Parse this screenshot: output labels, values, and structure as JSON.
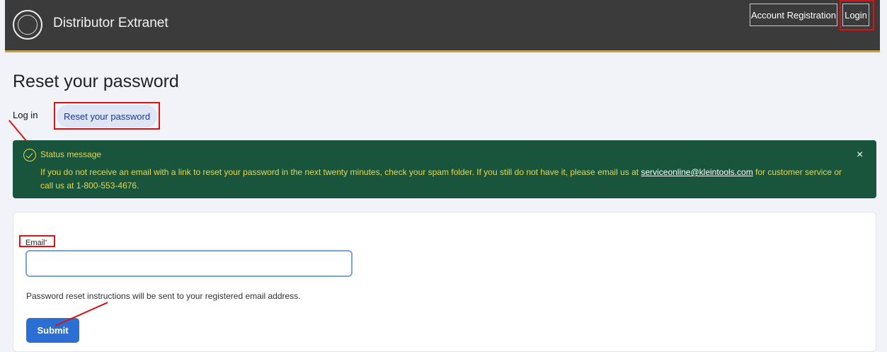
{
  "header": {
    "logo_text": "KLEIN TOOLS EST 1857",
    "site_title": "Distributor Extranet",
    "account_registration_label": "Account Registration",
    "login_label": "Login"
  },
  "page": {
    "title": "Reset your password"
  },
  "tabs": [
    {
      "label": "Log in",
      "active": false
    },
    {
      "label": "Reset your password",
      "active": true
    }
  ],
  "status": {
    "title": "Status message",
    "message_before": "If you do not receive an email with a link to reset your password in the next twenty minutes, check your spam folder. If you still do not have it, please email us at ",
    "email": "serviceonline@kleintools.com",
    "message_after": " for customer service or call us at 1-800-553-4676.",
    "close_label": "×",
    "color": "#19553d"
  },
  "form": {
    "email_label": "Email",
    "required_mark": "*",
    "email_value": "",
    "help_text": "Password reset instructions will be sent to your registered email address.",
    "submit_label": "Submit"
  },
  "colors": {
    "header_bg": "#3b3b3b",
    "accent": "#d4a21a",
    "primary_button": "#2c6fd4",
    "annotation": "#dd1111"
  }
}
